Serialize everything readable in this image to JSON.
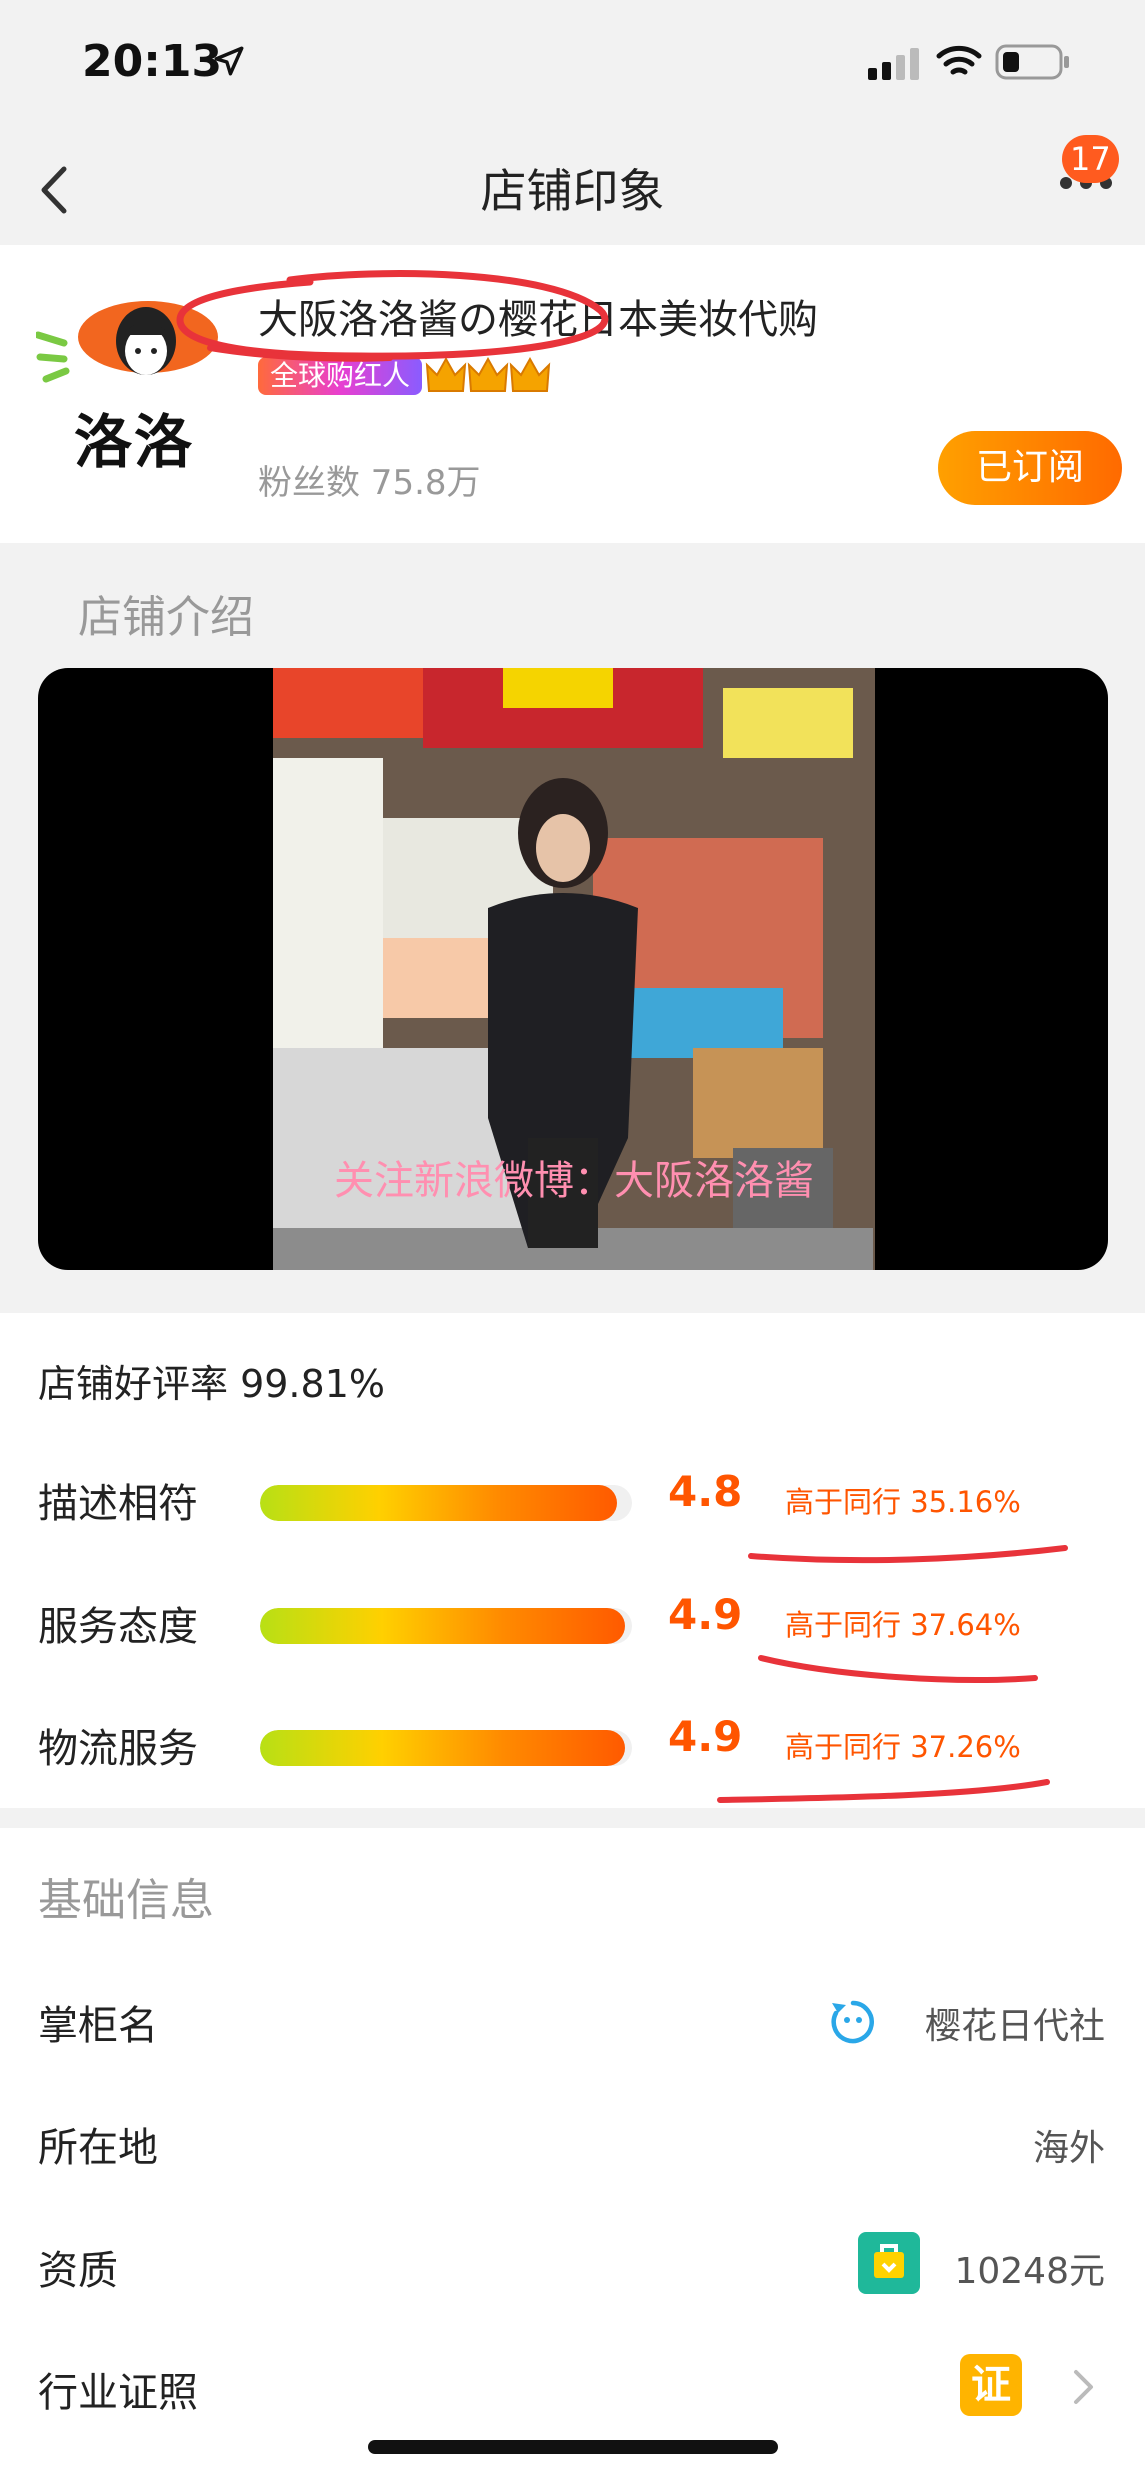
{
  "status_bar": {
    "time": "20:13"
  },
  "nav": {
    "title": "店铺印象",
    "badge_count": "17"
  },
  "shop": {
    "name": "大阪洛洛酱の樱花日本美妆代购",
    "tag": "全球购红人",
    "crowns": 3,
    "fans_label": "粉丝数 75.8万",
    "logo_text": "洛洛",
    "subscribe_label": "已订阅"
  },
  "intro": {
    "title": "店铺介绍",
    "video_caption": "关注新浪微博：大阪洛洛酱"
  },
  "ratings": {
    "good_rate": "店铺好评率 99.81%",
    "items": [
      {
        "label": "描述相符",
        "score": "4.8",
        "fill_fraction": 0.96,
        "compare": "高于同行 35.16%"
      },
      {
        "label": "服务态度",
        "score": "4.9",
        "fill_fraction": 0.98,
        "compare": "高于同行 37.64%"
      },
      {
        "label": "物流服务",
        "score": "4.9",
        "fill_fraction": 0.98,
        "compare": "高于同行 37.26%"
      }
    ]
  },
  "basic_info": {
    "title": "基础信息",
    "rows": [
      {
        "label": "掌柜名",
        "value": "樱花日代社",
        "icon": "wangwang-icon"
      },
      {
        "label": "所在地",
        "value": "海外"
      },
      {
        "label": "资质",
        "value": "10248元",
        "icon": "deposit-icon"
      },
      {
        "label": "行业证照",
        "value": "证",
        "icon": "certificate-icon"
      }
    ]
  },
  "colors": {
    "accent": "#ff5500",
    "subscribe": "#ff8a00",
    "annotation": "#e8333a"
  }
}
